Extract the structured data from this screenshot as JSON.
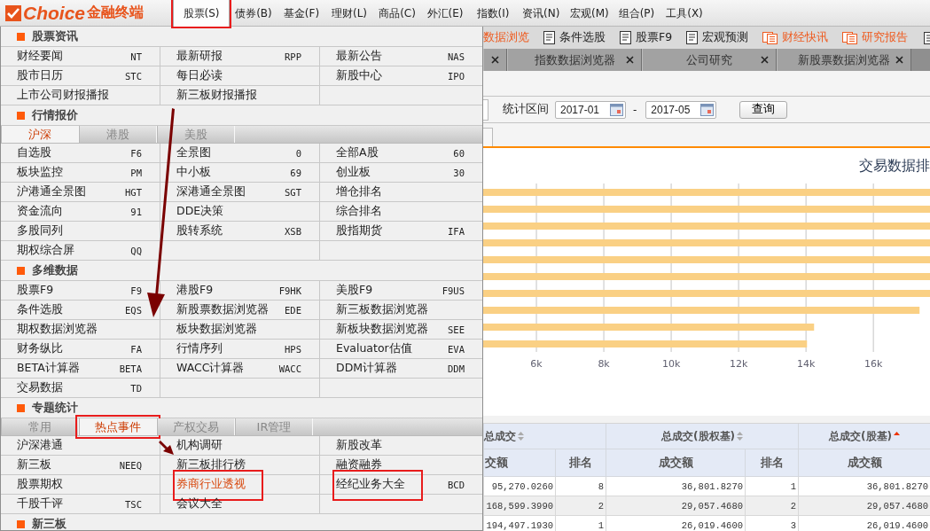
{
  "logo": {
    "brand": "Choice",
    "suffix": "金融终端"
  },
  "menu_bar": [
    {
      "label": "股票(S)",
      "selected": true,
      "highlighted": true
    },
    {
      "label": "债券(B)",
      "selected": false,
      "highlighted": false
    },
    {
      "label": "基金(F)",
      "selected": false,
      "highlighted": false
    },
    {
      "label": "理财(L)",
      "selected": false,
      "highlighted": false
    },
    {
      "label": "商品(C)",
      "selected": false,
      "highlighted": false
    },
    {
      "label": "外汇(E)",
      "selected": false,
      "highlighted": false
    },
    {
      "label": "指数(I)",
      "selected": false,
      "highlighted": false
    },
    {
      "label": "资讯(N)",
      "selected": false,
      "highlighted": false
    },
    {
      "label": "宏观(M)",
      "selected": false,
      "highlighted": false
    },
    {
      "label": "组合(P)",
      "selected": false,
      "highlighted": false
    },
    {
      "label": "工具(X)",
      "selected": false,
      "highlighted": false
    }
  ],
  "dropdown": {
    "sections": [
      {
        "title": "股票资讯",
        "rows": [
          [
            {
              "label": "财经要闻",
              "code": "NT",
              "selected": false,
              "highlighted": false
            },
            {
              "label": "最新研报",
              "code": "RPP",
              "selected": false,
              "highlighted": false
            },
            {
              "label": "最新公告",
              "code": "NAS",
              "selected": false,
              "highlighted": false
            }
          ],
          [
            {
              "label": "股市日历",
              "code": "STC",
              "selected": false,
              "highlighted": false
            },
            {
              "label": "每日必读",
              "selected": false,
              "highlighted": false
            },
            {
              "label": "新股中心",
              "code": "IPO",
              "selected": false,
              "highlighted": false
            }
          ],
          [
            {
              "label": "上市公司财报播报",
              "selected": false,
              "highlighted": false
            },
            {
              "label": "新三板财报播报",
              "selected": false,
              "highlighted": false
            }
          ]
        ]
      },
      {
        "title": "行情报价",
        "tabs": [
          {
            "label": "沪深",
            "selected": true,
            "highlighted": false
          },
          {
            "label": "港股",
            "selected": false,
            "highlighted": false
          },
          {
            "label": "美股",
            "selected": false,
            "highlighted": false
          }
        ],
        "rows": [
          [
            {
              "label": "自选股",
              "code": "F6",
              "selected": false,
              "highlighted": false
            },
            {
              "label": "全景图",
              "code": "0",
              "selected": false,
              "highlighted": false
            },
            {
              "label": "全部A股",
              "code": "60",
              "selected": false,
              "highlighted": false
            }
          ],
          [
            {
              "label": "板块监控",
              "code": "PM",
              "selected": false,
              "highlighted": false
            },
            {
              "label": "中小板",
              "code": "69",
              "selected": false,
              "highlighted": false
            },
            {
              "label": "创业板",
              "code": "30",
              "selected": false,
              "highlighted": false
            }
          ],
          [
            {
              "label": "沪港通全景图",
              "code": "HGT",
              "selected": false,
              "highlighted": false
            },
            {
              "label": "深港通全景图",
              "code": "SGT",
              "selected": false,
              "highlighted": false
            },
            {
              "label": "增仓排名",
              "selected": false,
              "highlighted": false
            }
          ],
          [
            {
              "label": "资金流向",
              "code": "91",
              "selected": false,
              "highlighted": false
            },
            {
              "label": "DDE决策",
              "selected": false,
              "highlighted": false
            },
            {
              "label": "综合排名",
              "selected": false,
              "highlighted": false
            }
          ],
          [
            {
              "label": "多股同列",
              "selected": false,
              "highlighted": false
            },
            {
              "label": "股转系统",
              "code": "XSB",
              "selected": false,
              "highlighted": false
            },
            {
              "label": "股指期货",
              "code": "IFA",
              "selected": false,
              "highlighted": false
            }
          ],
          [
            {
              "label": "期权综合屏",
              "code": "QQ",
              "selected": false,
              "highlighted": false
            }
          ]
        ]
      },
      {
        "title": "多维数据",
        "rows": [
          [
            {
              "label": "股票F9",
              "code": "F9",
              "selected": false,
              "highlighted": false
            },
            {
              "label": "港股F9",
              "code": "F9HK",
              "selected": false,
              "highlighted": false
            },
            {
              "label": "美股F9",
              "code": "F9US",
              "selected": false,
              "highlighted": false
            }
          ],
          [
            {
              "label": "条件选股",
              "code": "EQS",
              "selected": false,
              "highlighted": false
            },
            {
              "label": "新股票数据浏览器",
              "code": "EDE",
              "selected": false,
              "highlighted": false
            },
            {
              "label": "新三板数据浏览器",
              "selected": false,
              "highlighted": false
            }
          ],
          [
            {
              "label": "期权数据浏览器",
              "selected": false,
              "highlighted": false
            },
            {
              "label": "板块数据浏览器",
              "selected": false,
              "highlighted": false
            },
            {
              "label": "新板块数据浏览器",
              "code": "SEE",
              "selected": false,
              "highlighted": false
            }
          ],
          [
            {
              "label": "财务纵比",
              "code": "FA",
              "selected": false,
              "highlighted": false
            },
            {
              "label": "行情序列",
              "code": "HPS",
              "selected": false,
              "highlighted": false
            },
            {
              "label": "Evaluator估值",
              "code": "EVA",
              "selected": false,
              "highlighted": false
            }
          ],
          [
            {
              "label": "BETA计算器",
              "code": "BETA",
              "selected": false,
              "highlighted": false
            },
            {
              "label": "WACC计算器",
              "code": "WACC",
              "selected": false,
              "highlighted": false
            },
            {
              "label": "DDM计算器",
              "code": "DDM",
              "selected": false,
              "highlighted": false
            }
          ],
          [
            {
              "label": "交易数据",
              "code": "TD",
              "selected": false,
              "highlighted": false
            }
          ]
        ]
      },
      {
        "title": "专题统计",
        "tabs": [
          {
            "label": "常用",
            "selected": false,
            "highlighted": false
          },
          {
            "label": "热点事件",
            "selected": true,
            "highlighted": true
          },
          {
            "label": "产权交易",
            "selected": false,
            "highlighted": false
          },
          {
            "label": "IR管理",
            "selected": false,
            "highlighted": false
          }
        ],
        "rows": [
          [
            {
              "label": "沪深港通",
              "selected": false,
              "highlighted": false
            },
            {
              "label": "机构调研",
              "selected": false,
              "highlighted": false
            },
            {
              "label": "新股改革",
              "selected": false,
              "highlighted": false
            }
          ],
          [
            {
              "label": "新三板",
              "code": "NEEQ",
              "selected": false,
              "highlighted": false
            },
            {
              "label": "新三板排行榜",
              "selected": false,
              "highlighted": false
            },
            {
              "label": "融资融券",
              "selected": false,
              "highlighted": false
            }
          ],
          [
            {
              "label": "股票期权",
              "selected": false,
              "highlighted": false
            },
            {
              "label": "券商行业透视",
              "selected": true,
              "highlighted": true
            },
            {
              "label": "经纪业务大全",
              "code": "BCD",
              "selected": false,
              "highlighted": true
            }
          ],
          [
            {
              "label": "千股千评",
              "code": "TSC",
              "selected": false,
              "highlighted": false
            },
            {
              "label": "会议大全",
              "selected": false,
              "highlighted": false
            }
          ]
        ]
      },
      {
        "title": "新三板"
      }
    ]
  },
  "toolbar": [
    {
      "label": "数据浏览",
      "kind": "news",
      "partial": true
    },
    {
      "label": "条件选股",
      "kind": "doc",
      "partial": false
    },
    {
      "label": "股票F9",
      "kind": "doc",
      "partial": false
    },
    {
      "label": "宏观预测",
      "kind": "doc",
      "partial": false
    },
    {
      "label": "财经快讯",
      "kind": "news",
      "partial": false
    },
    {
      "label": "研究报告",
      "kind": "news",
      "partial": false
    }
  ],
  "tabs": [
    {
      "label": "指数数据浏览器",
      "selected": false
    },
    {
      "label": "公司研究",
      "selected": false
    },
    {
      "label": "新股票数据浏览器",
      "selected": false
    }
  ],
  "filter": {
    "label": "统计区间",
    "start": "2017-01",
    "separator": "-",
    "end": "2017-05",
    "button": "查询"
  },
  "chart": {
    "title": "交易数据排",
    "chart_data": {
      "type": "bar",
      "orientation": "horizontal",
      "grid": true,
      "values": [
        17680,
        17680,
        17680,
        17680,
        17680,
        17680,
        17680,
        17370,
        14240,
        14030
      ],
      "xlim": [
        4420,
        17680
      ],
      "xticks": [
        {
          "value": 6000,
          "label": "6k"
        },
        {
          "value": 8000,
          "label": "8k"
        },
        {
          "value": 10000,
          "label": "10k"
        },
        {
          "value": 12000,
          "label": "12k"
        },
        {
          "value": 14000,
          "label": "14k"
        },
        {
          "value": 16000,
          "label": "16k"
        }
      ]
    }
  },
  "table": {
    "groups": [
      {
        "label": "总成交",
        "sorted": false
      },
      {
        "label": "总成交(股权基)",
        "sorted": false
      },
      {
        "label": "总成交(股基)",
        "sorted": true
      }
    ],
    "columns": [
      "交额",
      "排名",
      "成交额",
      "排名",
      "成交额"
    ],
    "rows": [
      [
        "95,270.0260",
        "8",
        "36,801.8270",
        "1",
        "36,801.8270"
      ],
      [
        "168,599.3990",
        "2",
        "29,057.4680",
        "2",
        "29,057.4680"
      ],
      [
        "194,497.1930",
        "1",
        "26,019.4600",
        "3",
        "26,019.4600"
      ]
    ]
  }
}
